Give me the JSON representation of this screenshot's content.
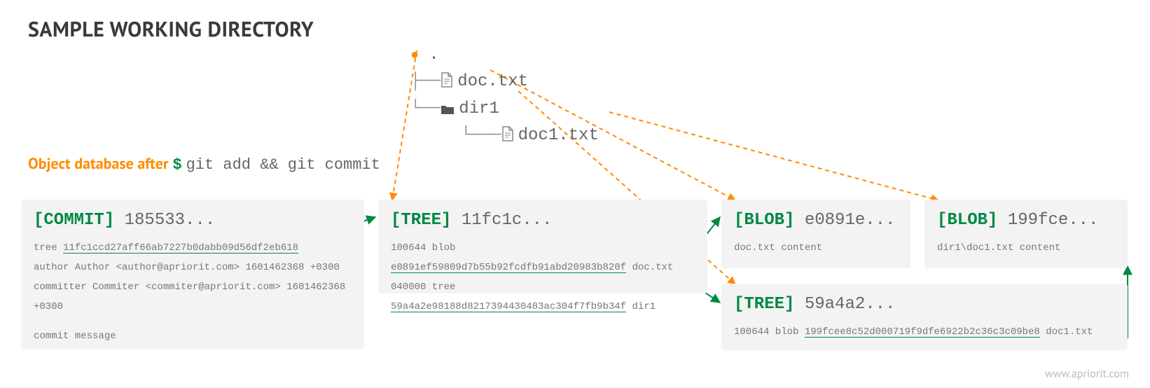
{
  "title": "SAMPLE WORKING DIRECTORY",
  "filetree": {
    "root": ".",
    "file1": "doc.txt",
    "dir1": "dir1",
    "file2": "doc1.txt"
  },
  "subtitle": {
    "label": "Object database after",
    "prompt": "$",
    "command": "git add && git commit"
  },
  "commit": {
    "tag": "[COMMIT]",
    "hash": "185533...",
    "line1_pre": "tree ",
    "line1_hash": "11fc1ccd27aff66ab7227b0dabb09d56df2eb618",
    "line2": "author Author <author@apriorit.com> 1601462368 +0300",
    "line3": "committer Commiter <commiter@apriorit.com> 1601462368 +0300",
    "line4": "commit message"
  },
  "tree1": {
    "tag": "[TREE]",
    "hash": "11fc1c...",
    "row1_pre": "100644 blob ",
    "row1_hash": "e0891ef59809d7b55b92fcdfb91abd20983b820f",
    "row1_name": "  doc.txt",
    "row2_pre": "040000 tree ",
    "row2_hash": "59a4a2e98188d8217394430483ac304f7fb9b34f",
    "row2_name": "  dir1"
  },
  "blob1": {
    "tag": "[BLOB]",
    "hash": "e0891e...",
    "body": "doc.txt content"
  },
  "blob2": {
    "tag": "[BLOB]",
    "hash": "199fce...",
    "body": "dir1\\doc1.txt content"
  },
  "tree2": {
    "tag": "[TREE]",
    "hash": "59a4a2...",
    "row1_pre": "100644 blob ",
    "row1_hash": "199fcee8c52d000719f9dfe6922b2c36c3c09be8",
    "row1_name": "   doc1.txt"
  },
  "footer": "www.apriorit.com"
}
